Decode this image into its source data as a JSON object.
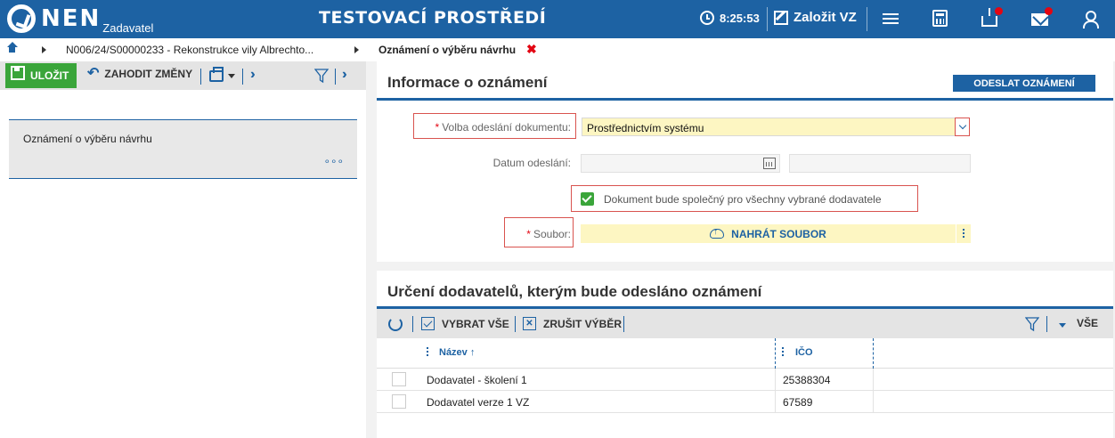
{
  "header": {
    "logo_text": "NEN",
    "logo_sub": "Zadavatel",
    "env_title": "TESTOVACÍ PROSTŘEDÍ",
    "clock": "8:25:53",
    "create_vz": "Založit VZ",
    "accent_color": "#1d62a3",
    "notification_color": "#e30613"
  },
  "breadcrumb": {
    "path_item": "N006/24/S00000233 - Rekonstrukce vily Albrechto...",
    "current": "Oznámení o výběru návrhu"
  },
  "left_toolbar": {
    "save_label": "ULOŽIT",
    "discard_label": "ZAHODIT ZMĚNY"
  },
  "left_card": {
    "title": "Oznámení o výběru návrhu",
    "more": "∘∘∘"
  },
  "info_section": {
    "title": "Informace o oznámení",
    "send_button": "ODESLAT OZNÁMENÍ",
    "send_method_label": "Volba odeslání dokumentu:",
    "send_method_value": "Prostřednictvím systému",
    "send_date_label": "Datum odeslání:",
    "send_date_value": "",
    "common_doc_label": "Dokument bude společný pro všechny vybrané dodavatele",
    "common_doc_checked": true,
    "file_label": "Soubor:",
    "upload_button": "NAHRÁT SOUBOR"
  },
  "suppliers_section": {
    "title": "Určení dodavatelů, kterým bude odesláno oznámení",
    "select_all": "VYBRAT VŠE",
    "deselect": "ZRUŠIT VÝBĚR",
    "view_all": "VŠE",
    "columns": [
      "Název",
      "IČO"
    ],
    "sort_indicator": "↑",
    "rows": [
      {
        "name": "Dodavatel - školení 1",
        "ico": "25388304"
      },
      {
        "name": "Dodavatel verze 1 VZ",
        "ico": "67589"
      }
    ]
  }
}
